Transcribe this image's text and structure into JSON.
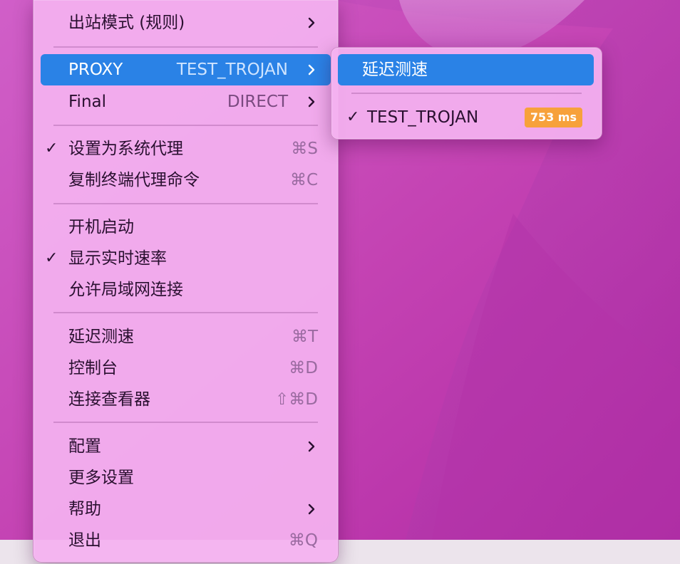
{
  "colors": {
    "highlight": "#2a82e6",
    "latency_badge": "#f7a13b",
    "menu_bg": "#f4b2f0"
  },
  "main_menu": {
    "outbound_mode": {
      "label": "出站模式 (规则)"
    },
    "proxy": {
      "label": "PROXY",
      "value": "TEST_TROJAN"
    },
    "final": {
      "label": "Final",
      "value": "DIRECT"
    },
    "set_system_proxy": {
      "label": "设置为系统代理",
      "shortcut": "⌘S",
      "checked": true
    },
    "copy_terminal_proxy": {
      "label": "复制终端代理命令",
      "shortcut": "⌘C"
    },
    "launch_at_login": {
      "label": "开机启动"
    },
    "show_realtime_speed": {
      "label": "显示实时速率",
      "checked": true
    },
    "allow_lan": {
      "label": "允许局域网连接"
    },
    "latency_test": {
      "label": "延迟测速",
      "shortcut": "⌘T"
    },
    "console": {
      "label": "控制台",
      "shortcut": "⌘D"
    },
    "connection_viewer": {
      "label": "连接查看器",
      "shortcut": "⇧⌘D"
    },
    "config": {
      "label": "配置"
    },
    "more_settings": {
      "label": "更多设置"
    },
    "help": {
      "label": "帮助"
    },
    "quit": {
      "label": "退出",
      "shortcut": "⌘Q"
    }
  },
  "sub_menu": {
    "latency_test": {
      "label": "延迟测速"
    },
    "nodes": [
      {
        "label": "TEST_TROJAN",
        "latency": "753 ms",
        "checked": true
      }
    ]
  },
  "check_glyph": "✓",
  "icons": {
    "submenu_arrow": "chevron-right-icon",
    "checkmark": "checkmark-icon"
  }
}
